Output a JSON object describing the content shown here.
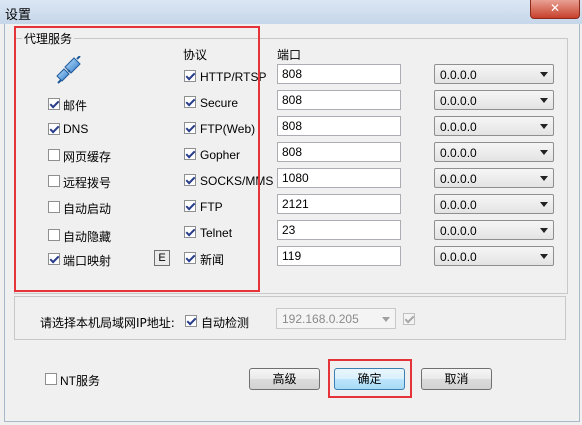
{
  "window": {
    "title": "设置",
    "close_glyph": "✕"
  },
  "proxy_group": {
    "caption": "代理服务",
    "protocol_header": "协议",
    "port_header": "端口",
    "options": [
      {
        "label": "邮件",
        "checked": true
      },
      {
        "label": "DNS",
        "checked": true
      },
      {
        "label": "网页缓存",
        "checked": false
      },
      {
        "label": "远程拨号",
        "checked": false
      },
      {
        "label": "自动启动",
        "checked": false
      },
      {
        "label": "自动隐藏",
        "checked": false
      },
      {
        "label": "端口映射",
        "checked": true
      }
    ],
    "port_map_button": "E",
    "protocols": [
      {
        "label": "HTTP/RTSP",
        "checked": true,
        "port": "808",
        "bind": "0.0.0.0"
      },
      {
        "label": "Secure",
        "checked": true,
        "port": "808",
        "bind": "0.0.0.0"
      },
      {
        "label": "FTP(Web)",
        "checked": true,
        "port": "808",
        "bind": "0.0.0.0"
      },
      {
        "label": "Gopher",
        "checked": true,
        "port": "808",
        "bind": "0.0.0.0"
      },
      {
        "label": "SOCKS/MMS",
        "checked": true,
        "port": "1080",
        "bind": "0.0.0.0"
      },
      {
        "label": "FTP",
        "checked": true,
        "port": "2121",
        "bind": "0.0.0.0"
      },
      {
        "label": "Telnet",
        "checked": true,
        "port": "23",
        "bind": "0.0.0.0"
      },
      {
        "label": "新闻",
        "checked": true,
        "port": "119",
        "bind": "0.0.0.0"
      }
    ]
  },
  "lan_ip": {
    "label": "请选择本机局域网IP地址:",
    "auto_detect_label": "自动检测",
    "auto_detect_checked": true,
    "ip_value": "192.168.0.205",
    "extra_checked": true
  },
  "footer": {
    "nt_service_label": "NT服务",
    "nt_service_checked": false,
    "advanced_label": "高级",
    "ok_label": "确定",
    "cancel_label": "取消"
  },
  "colors": {
    "highlight": "#e5333a",
    "check": "#2a3f8c"
  }
}
